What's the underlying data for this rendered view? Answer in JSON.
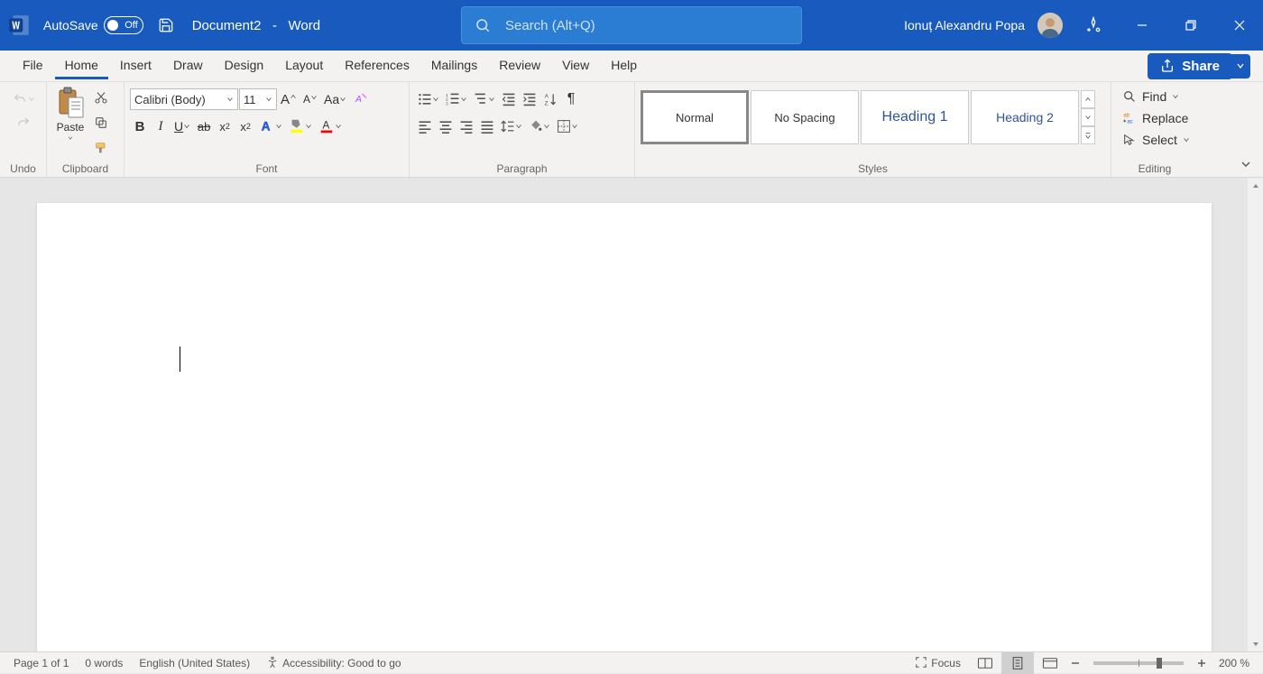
{
  "titlebar": {
    "autosave_label": "AutoSave",
    "autosave_state": "Off",
    "doc_name": "Document2",
    "separator": "-",
    "app_name": "Word",
    "search_placeholder": "Search (Alt+Q)",
    "user_name": "Ionuț Alexandru Popa"
  },
  "tabs": {
    "file": "File",
    "home": "Home",
    "insert": "Insert",
    "draw": "Draw",
    "design": "Design",
    "layout": "Layout",
    "references": "References",
    "mailings": "Mailings",
    "review": "Review",
    "view": "View",
    "help": "Help",
    "share": "Share"
  },
  "ribbon": {
    "undo": {
      "label": "Undo"
    },
    "clipboard": {
      "label": "Clipboard",
      "paste": "Paste"
    },
    "font": {
      "label": "Font",
      "font_name": "Calibri (Body)",
      "font_size": "11"
    },
    "paragraph": {
      "label": "Paragraph"
    },
    "styles": {
      "label": "Styles",
      "items": [
        "Normal",
        "No Spacing",
        "Heading 1",
        "Heading 2"
      ]
    },
    "editing": {
      "label": "Editing",
      "find": "Find",
      "replace": "Replace",
      "select": "Select"
    }
  },
  "statusbar": {
    "page": "Page 1 of 1",
    "words": "0 words",
    "language": "English (United States)",
    "accessibility": "Accessibility: Good to go",
    "focus": "Focus",
    "zoom": "200 %"
  }
}
